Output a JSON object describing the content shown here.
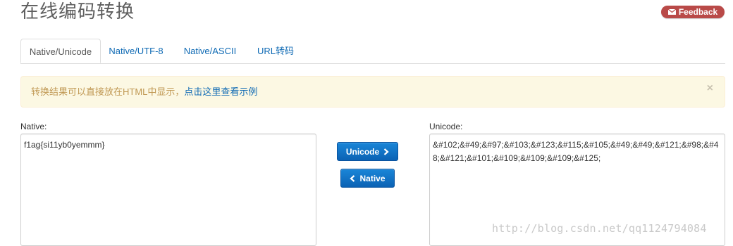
{
  "header": {
    "title": "在线编码转换",
    "feedback_label": "Feedback"
  },
  "tabs": [
    {
      "label": "Native/Unicode",
      "active": true
    },
    {
      "label": "Native/UTF-8",
      "active": false
    },
    {
      "label": "Native/ASCII",
      "active": false
    },
    {
      "label": "URL转码",
      "active": false
    }
  ],
  "alert": {
    "message": "转换结果可以直接放在HTML中显示，",
    "link": "点击这里查看示例",
    "close": "×"
  },
  "native": {
    "label": "Native:",
    "value": "f1ag{si11yb0yemmm}"
  },
  "unicode": {
    "label": "Unicode:",
    "value": "&#102;&#49;&#97;&#103;&#123;&#115;&#105;&#49;&#49;&#121;&#98;&#48;&#121;&#101;&#109;&#109;&#109;&#125;"
  },
  "buttons": {
    "to_unicode": "Unicode",
    "to_native": "Native"
  },
  "watermark": "http://blog.csdn.net/qq1124794084",
  "colors": {
    "link": "#0f6ab4",
    "alert_bg": "#fcf8e3",
    "alert_text": "#c09853",
    "feedback_bg": "#b94a48",
    "button": "#0b62b4"
  },
  "icons": [
    "envelope-icon",
    "close-icon",
    "chevron-right-icon",
    "chevron-left-icon"
  ]
}
